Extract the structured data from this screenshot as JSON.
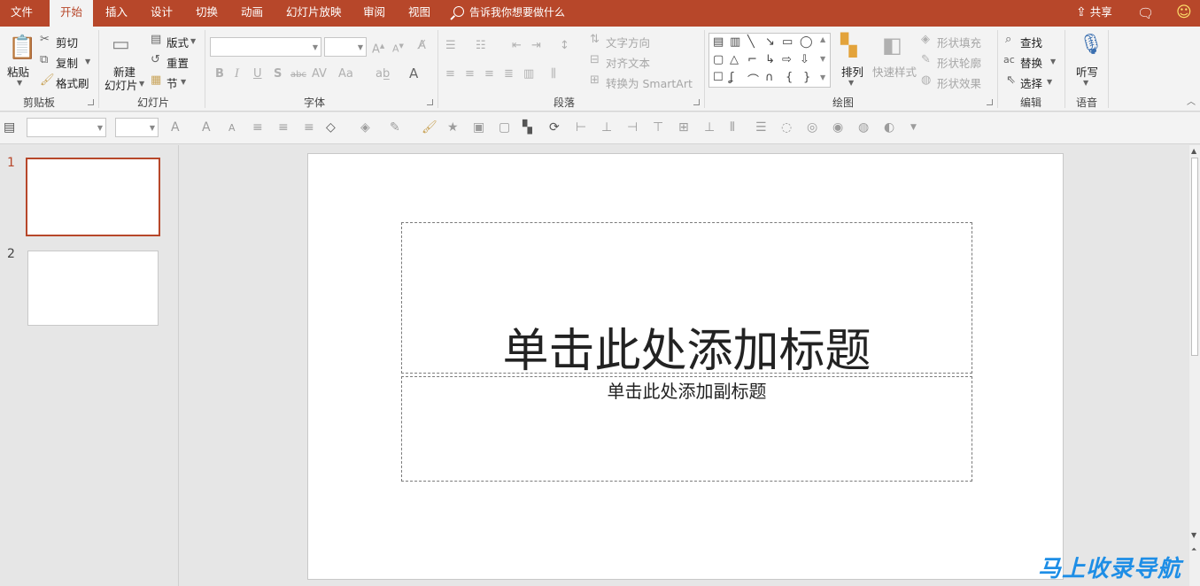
{
  "tabs": [
    {
      "label": "文件",
      "active": false
    },
    {
      "label": "开始",
      "active": true
    },
    {
      "label": "插入",
      "active": false
    },
    {
      "label": "设计",
      "active": false
    },
    {
      "label": "切换",
      "active": false
    },
    {
      "label": "动画",
      "active": false
    },
    {
      "label": "幻灯片放映",
      "active": false
    },
    {
      "label": "审阅",
      "active": false
    },
    {
      "label": "视图",
      "active": false
    }
  ],
  "tell_me": "告诉我你想要做什么",
  "share_label": "共享",
  "ribbon": {
    "clipboard": {
      "paste": "粘贴",
      "cut": "剪切",
      "copy": "复制",
      "format_painter": "格式刷",
      "group": "剪贴板"
    },
    "slides": {
      "new_slide_line1": "新建",
      "new_slide_line2": "幻灯片",
      "layout": "版式",
      "reset": "重置",
      "section": "节",
      "group": "幻灯片"
    },
    "font": {
      "group": "字体",
      "bold": "B",
      "italic": "I",
      "underline": "U",
      "shadow": "S",
      "strike": "abc",
      "spacing": "AV",
      "case": "Aa",
      "grow": "A",
      "shrink": "A"
    },
    "paragraph": {
      "text_direction": "文字方向",
      "align_text": "对齐文本",
      "convert_smartart": "转换为 SmartArt",
      "group": "段落"
    },
    "drawing": {
      "arrange": "排列",
      "quick_styles": "快速样式",
      "shape_fill": "形状填充",
      "shape_outline": "形状轮廓",
      "shape_effects": "形状效果",
      "group": "绘图"
    },
    "editing": {
      "find": "查找",
      "replace": "替换",
      "select": "选择",
      "group": "编辑"
    },
    "voice": {
      "dictate": "听写",
      "group": "语音"
    }
  },
  "thumbnails": [
    {
      "number": "1",
      "active": true
    },
    {
      "number": "2",
      "active": false
    }
  ],
  "slide": {
    "title_placeholder": "单击此处添加标题",
    "subtitle_placeholder": "单击此处添加副标题"
  },
  "watermark": "马上收录导航",
  "colors": {
    "accent": "#b7472a",
    "ribbon_bg": "#f3f3f3",
    "workspace_bg": "#e6e6e6"
  }
}
